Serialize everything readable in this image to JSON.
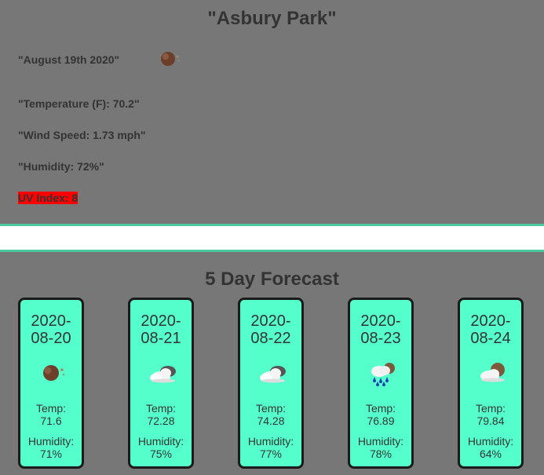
{
  "current": {
    "city": "\"Asbury Park\"",
    "date": "\"August 19th 2020\"",
    "temperature": "\"Temperature (F): 70.2\"",
    "wind": "\"Wind Speed: 1.73 mph\"",
    "humidity": "\"Humidity: 72%\"",
    "uv": "UV Index: 8",
    "icon": "moon-icon"
  },
  "forecast": {
    "title": "5 Day Forecast",
    "temp_label": "Temp:",
    "humidity_label": "Humidity:",
    "days": [
      {
        "date_top": "2020-",
        "date_bottom": "08-20",
        "icon": "moon-icon",
        "temp": "71.6",
        "humidity": "71%"
      },
      {
        "date_top": "2020-",
        "date_bottom": "08-21",
        "icon": "cloud-icon",
        "temp": "72.28",
        "humidity": "75%"
      },
      {
        "date_top": "2020-",
        "date_bottom": "08-22",
        "icon": "cloud-icon",
        "temp": "74.28",
        "humidity": "77%"
      },
      {
        "date_top": "2020-",
        "date_bottom": "08-23",
        "icon": "rain-icon",
        "temp": "76.89",
        "humidity": "78%"
      },
      {
        "date_top": "2020-",
        "date_bottom": "08-24",
        "icon": "partly-cloudy-icon",
        "temp": "79.84",
        "humidity": "64%"
      }
    ]
  },
  "colors": {
    "background": "#777777",
    "card": "#55ffcc",
    "divider": "#4dc9a0",
    "uv_high": "#ff0000"
  }
}
